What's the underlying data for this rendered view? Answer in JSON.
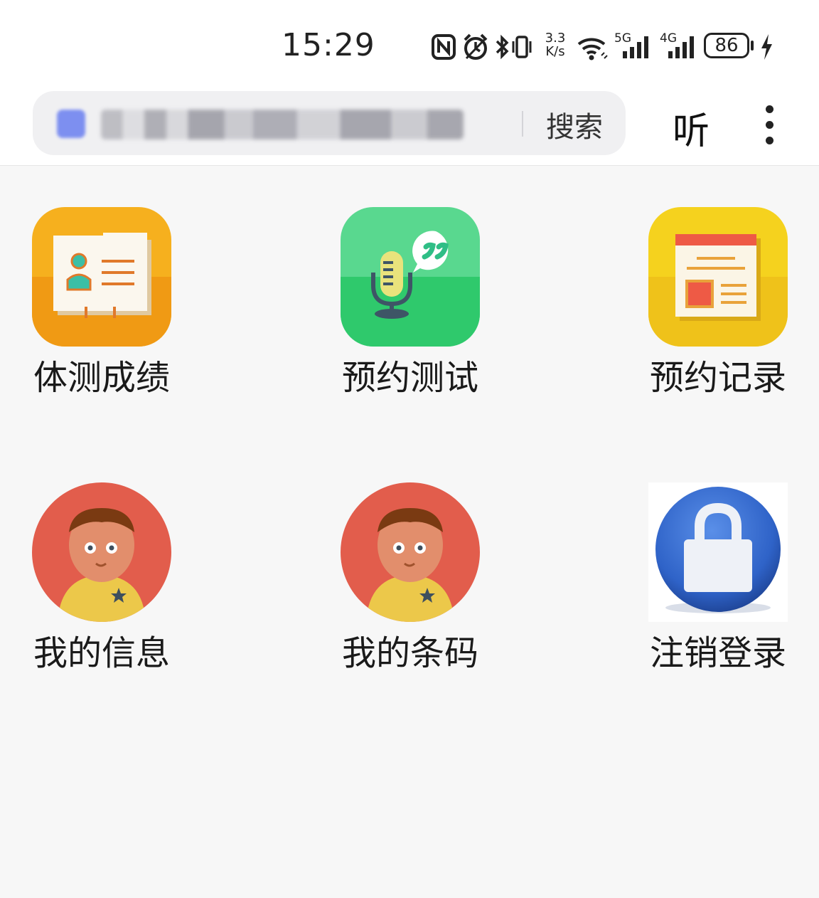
{
  "status_bar": {
    "time": "15:29",
    "net_speed_value": "3.3",
    "net_speed_unit": "K/s",
    "signal_5g_label": "5G",
    "signal_4g_label": "4G",
    "battery_level": "86",
    "icons": [
      "nfc-icon",
      "alarm-icon",
      "bluetooth-icon",
      "vibrate-icon",
      "wifi-icon",
      "signal-5g-icon",
      "signal-4g-icon",
      "battery-icon",
      "charging-icon"
    ]
  },
  "browser": {
    "search_label": "搜索",
    "listen_label": "听",
    "menu_icon": "more-vertical-icon"
  },
  "grid": {
    "items": [
      {
        "label": "体测成绩",
        "icon": "score-card-icon"
      },
      {
        "label": "预约测试",
        "icon": "microphone-quote-icon"
      },
      {
        "label": "预约记录",
        "icon": "document-record-icon"
      },
      {
        "label": "我的信息",
        "icon": "user-avatar-icon"
      },
      {
        "label": "我的条码",
        "icon": "user-avatar-icon"
      },
      {
        "label": "注销登录",
        "icon": "lock-icon"
      }
    ]
  },
  "colors": {
    "orange_tile": "#F5A21C",
    "green_tile": "#35C96E",
    "yellow_tile": "#F2C21B",
    "avatar_red": "#E25D4C",
    "lock_blue": "#2F63C8",
    "background": "#F7F7F7"
  }
}
